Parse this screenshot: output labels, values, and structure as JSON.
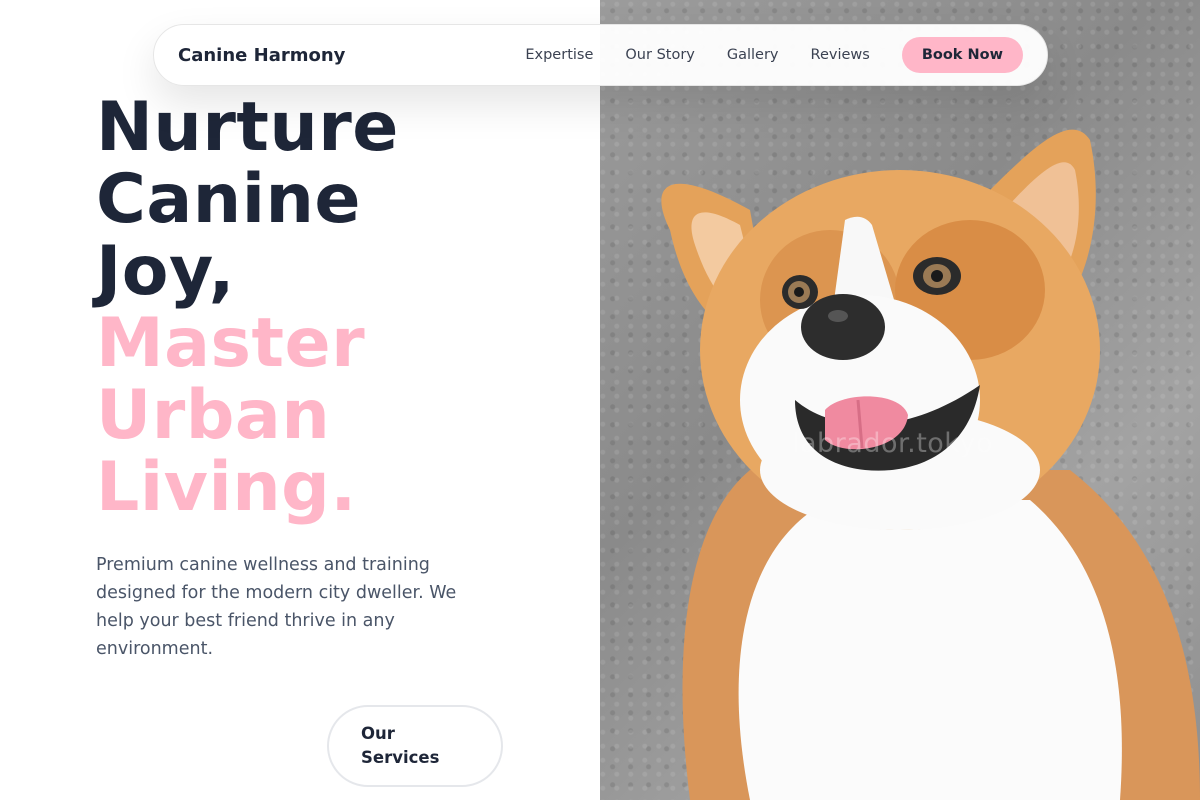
{
  "brand": "Canine Harmony",
  "nav": {
    "links": [
      "Expertise",
      "Our Story",
      "Gallery",
      "Reviews"
    ],
    "cta": "Book Now"
  },
  "hero": {
    "headline_dark": [
      "Nurture",
      "Canine",
      "Joy,"
    ],
    "headline_pink": [
      "Master",
      "Urban",
      "Living."
    ],
    "lead": "Premium canine wellness and training designed for the modern city dweller. We help your best friend thrive in any environment.",
    "secondary_cta": "Our Services"
  },
  "photo": {
    "subject": "corgi-dog-photo",
    "watermark": "labrador.tokyo"
  },
  "colors": {
    "dark": "#1e2638",
    "accent_pink": "#ffb6c8",
    "body_text": "#4a5568"
  }
}
